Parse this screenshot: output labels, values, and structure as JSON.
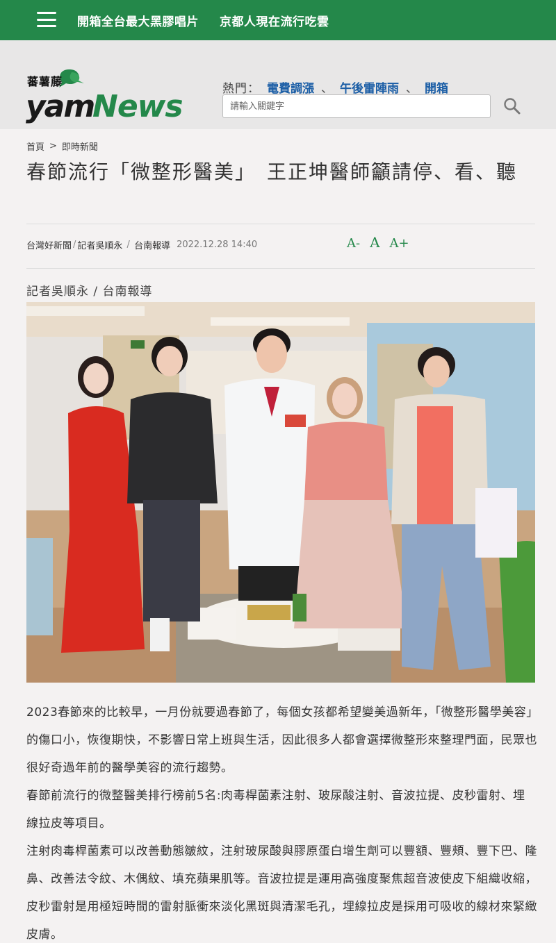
{
  "topbar": {
    "nav": [
      "開箱全台最大黑膠唱片",
      "京都人現在流行吃雲"
    ]
  },
  "logo": {
    "sub": "蕃薯藤",
    "main_yam": "yam",
    "main_news": "News"
  },
  "hot": {
    "label": "熱門：",
    "items": [
      "電費調漲",
      "午後雷陣雨",
      "開箱"
    ]
  },
  "search": {
    "placeholder": "請輸入關鍵字"
  },
  "breadcrumb": {
    "home": "首頁",
    "section": "即時新聞"
  },
  "article": {
    "title": "春節流行「微整形醫美」　王正坤醫師籲請停、看、聽",
    "source": "台灣好新聞",
    "author": "記者吳順永",
    "region": "台南報導",
    "date": "2022.12.28 14:40",
    "byline": "記者吳順永 / 台南報導",
    "paragraphs": [
      "2023春節來的比較早，一月份就要過春節了，每個女孩都希望變美過新年，「微整形醫學美容」的傷口小，恢復期快，不影響日常上班與生活，因此很多人都會選擇微整形來整理門面，民眾也很好奇過年前的醫學美容的流行趨勢。",
      "春節前流行的微整醫美排行榜前5名:肉毒桿菌素注射、玻尿酸注射、音波拉提、皮秒雷射、埋線拉皮等項目。",
      "注射肉毒桿菌素可以改善動態皺紋，注射玻尿酸與膠原蛋白增生劑可以豐額、豐頰、豐下巴、隆鼻、改善法令紋、木偶紋、填充蘋果肌等。音波拉提是運用高強度聚焦超音波使皮下組織收縮，皮秒雷射是用極短時間的雷射脈衝來淡化黑斑與清潔毛孔，埋線拉皮是採用可吸收的線材來緊緻皮膚。"
    ]
  },
  "fontsize": {
    "small": "A-",
    "normal": "A",
    "large": "A+"
  },
  "colors": {
    "brand_green": "#24884a",
    "link_blue": "#1b5ea6",
    "header_bg": "#e8e7e7",
    "page_bg": "#f4f2f2"
  }
}
